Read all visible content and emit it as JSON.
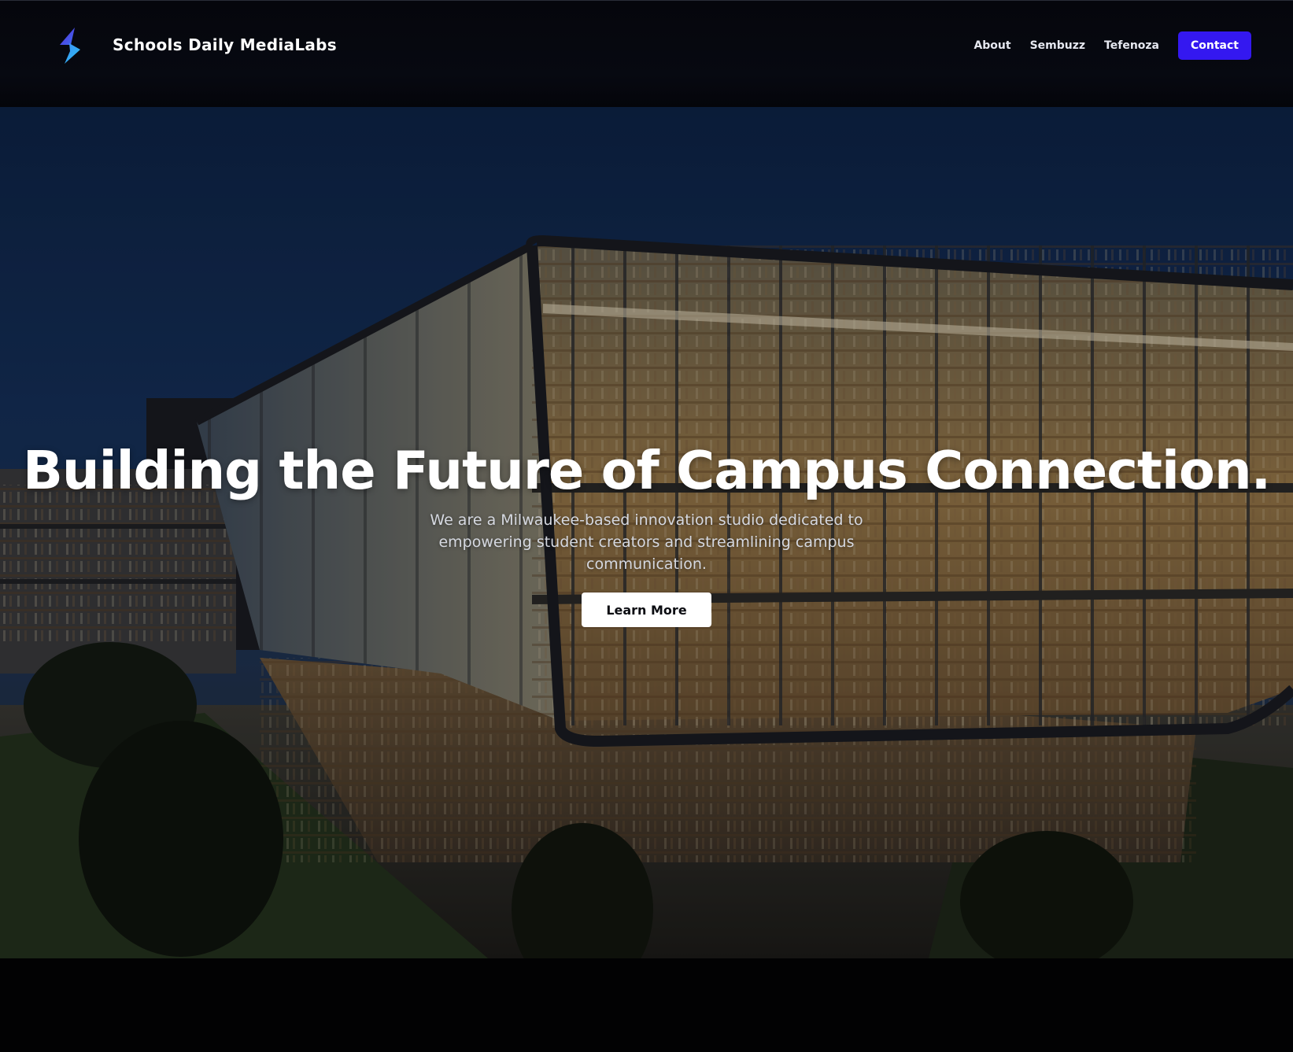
{
  "header": {
    "brand_name": "Schools Daily MediaLabs",
    "logo_icon": "lightning-bolt-logo",
    "nav": {
      "about": "About",
      "sembuzz": "Sembuzz",
      "tefenoza": "Tefenoza",
      "contact": "Contact"
    }
  },
  "hero": {
    "headline": "Building the Future of Campus Connection.",
    "subtext": "We are a Milwaukee-based innovation studio dedicated to empowering student creators and streamlining campus communication.",
    "cta_label": "Learn More",
    "background_image": "campus-library-building-at-dusk"
  },
  "colors": {
    "header_bg": "#070911",
    "accent": "#3418f0",
    "cta_bg": "#ffffff",
    "page_bg": "#030305"
  }
}
